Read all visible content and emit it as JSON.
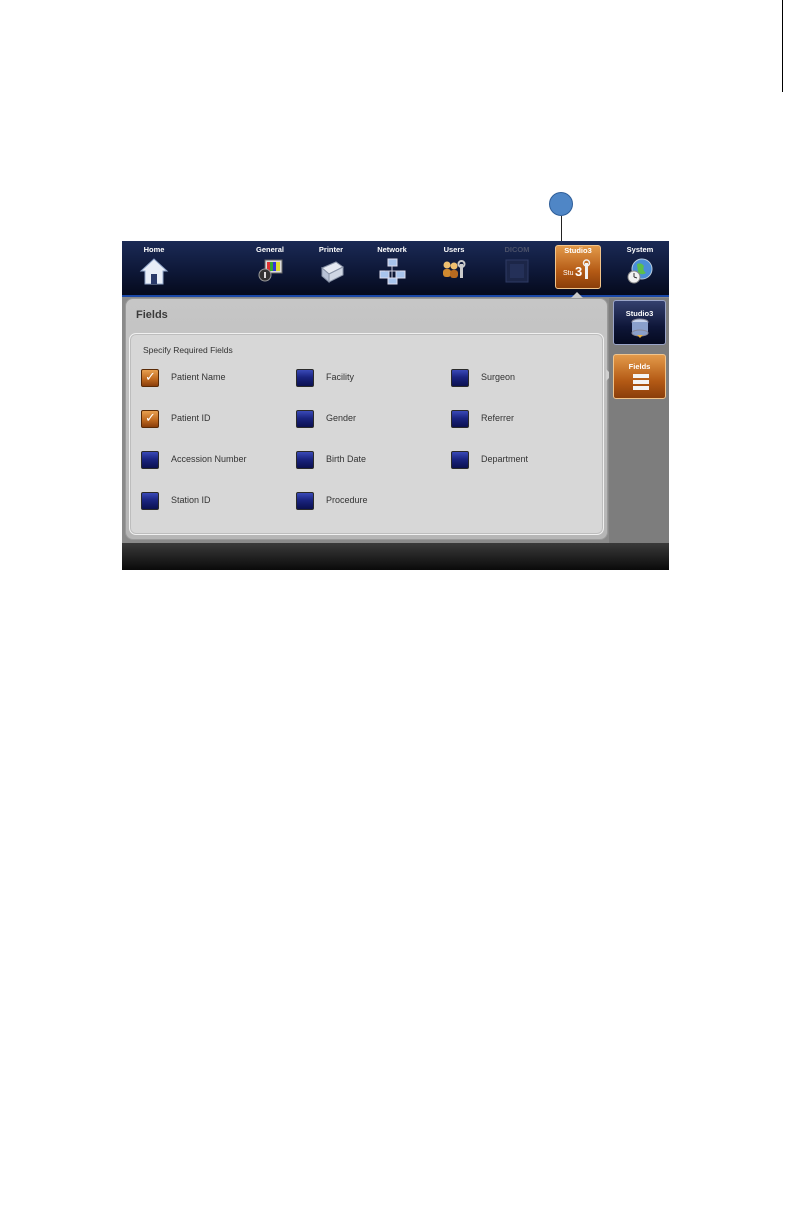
{
  "nav": {
    "items": [
      {
        "label": "Home",
        "icon": "house-icon"
      },
      {
        "label": "General",
        "icon": "monitor-icon"
      },
      {
        "label": "Printer",
        "icon": "printer-icon"
      },
      {
        "label": "Network",
        "icon": "network-icon"
      },
      {
        "label": "Users",
        "icon": "users-icon"
      },
      {
        "label": "DICOM",
        "icon": "dicom-icon"
      },
      {
        "label": "Studio3",
        "icon": "studio3-tools-icon"
      },
      {
        "label": "System",
        "icon": "globe-clock-icon"
      }
    ],
    "active": "Studio3"
  },
  "panel": {
    "title": "Fields",
    "section_title": "Specify Required Fields",
    "fields": [
      {
        "label": "Patient Name",
        "checked": true
      },
      {
        "label": "Facility",
        "checked": false
      },
      {
        "label": "Surgeon",
        "checked": false
      },
      {
        "label": "Patient ID",
        "checked": true
      },
      {
        "label": "Gender",
        "checked": false
      },
      {
        "label": "Referrer",
        "checked": false
      },
      {
        "label": "Accession Number",
        "checked": false
      },
      {
        "label": "Birth Date",
        "checked": false
      },
      {
        "label": "Department",
        "checked": false
      },
      {
        "label": "Station ID",
        "checked": false
      },
      {
        "label": "Procedure",
        "checked": false
      }
    ]
  },
  "sidebar": {
    "items": [
      {
        "label": "Studio3",
        "icon": "database-icon"
      },
      {
        "label": "Fields",
        "icon": "list-icon"
      }
    ]
  },
  "colors": {
    "nav_bg": "#0e1838",
    "accent_orange": "#c06a20",
    "checkbox_blue": "#1a2480",
    "callout_blue": "#4f86c6"
  }
}
